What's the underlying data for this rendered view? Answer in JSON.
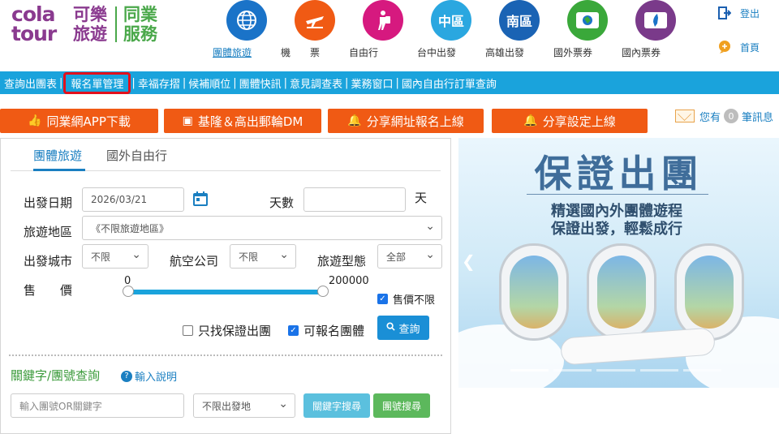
{
  "logo": {
    "brand_top": "cola",
    "brand_bottom": "tour",
    "company": "可樂旅遊",
    "division": "同業服務"
  },
  "nav": [
    {
      "label": "團體旅遊",
      "icon": "globe-icon",
      "color": "#1a73c8",
      "active": true
    },
    {
      "label": "機　　票",
      "icon": "airplane-icon",
      "color": "#f05a14",
      "active": false
    },
    {
      "label": "自由行",
      "icon": "backpacker-icon",
      "color": "#d6197f",
      "active": false
    },
    {
      "label": "台中出發",
      "icon": "region-taichung-icon",
      "glyph": "中區",
      "color": "#2aa7e0",
      "active": false
    },
    {
      "label": "高雄出發",
      "icon": "region-kaohsiung-icon",
      "glyph": "南區",
      "color": "#1a63b4",
      "active": false
    },
    {
      "label": "國外票券",
      "icon": "ticket-icon",
      "color": "#3aa83a",
      "active": false
    },
    {
      "label": "國內票券",
      "icon": "taiwan-ticket-icon",
      "color": "#7a3a8a",
      "active": false
    }
  ],
  "toplinks": {
    "logout": "登出",
    "home": "首頁"
  },
  "menubar": [
    "查詢出團表",
    "報名單管理",
    "幸福存摺",
    "候補順位",
    "團體快訊",
    "意見調查表",
    "業務窗口",
    "國內自由行訂單查詢"
  ],
  "actions": [
    "同業網APP下載",
    "基隆＆高出郵輪DM",
    "分享網址報名上線",
    "分享設定上線"
  ],
  "messages": {
    "prefix": "您有",
    "count": "0",
    "suffix": "筆訊息"
  },
  "search": {
    "tabs": [
      "團體旅遊",
      "國外自由行"
    ],
    "depart_label": "出發日期",
    "depart_value": "2026/03/21",
    "days_label": "天數",
    "days_unit": "天",
    "region_label": "旅遊地區",
    "region_value": "《不限旅遊地區》",
    "city_label": "出發城市",
    "city_value": "不限",
    "airline_label": "航空公司",
    "airline_value": "不限",
    "type_label": "旅遊型態",
    "type_value": "全部",
    "price_label": "售　　價",
    "price_min": "0",
    "price_max": "200000",
    "price_unlimited": "售價不限",
    "guaranteed_only": "只找保證出團",
    "bookable": "可報名團體",
    "search_btn": "查詢",
    "kw_title": "關鍵字/團號查詢",
    "help": "輸入說明",
    "kw_placeholder": "輸入團號OR關鍵字",
    "dep_place": "不限出發地",
    "kw_btn": "關鍵字搜尋",
    "code_btn": "團號搜尋"
  },
  "banner": {
    "title": "保證出團",
    "line1": "精選國內外團體遊程",
    "line2": "保證出發，輕鬆成行"
  }
}
